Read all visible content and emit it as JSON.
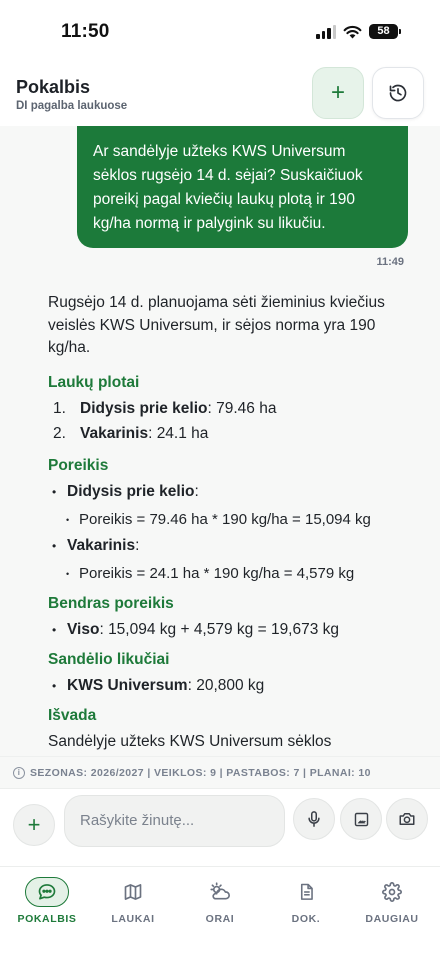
{
  "status": {
    "time": "11:50",
    "battery": "58"
  },
  "header": {
    "title": "Pokalbis",
    "subtitle": "DI pagalba laukuose"
  },
  "chat": {
    "user_message": "Ar sandėlyje užteks KWS Universum sėklos rugsėjo 14 d. sėjai? Suskaičiuok poreikį pagal kviečių laukų plotą ir 190 kg/ha normą ir palygink su likučiu.",
    "user_time": "11:49",
    "intro": "Rugsėjo 14 d. planuojama sėti žieminius kviečius veislės KWS Universum, ir sėjos norma yra 190 kg/ha.",
    "fields_heading": "Laukų plotai",
    "fields": [
      {
        "num": "1.",
        "name": "Didysis prie kelio",
        "value": ": 79.46 ha"
      },
      {
        "num": "2.",
        "name": "Vakarinis",
        "value": ": 24.1 ha"
      }
    ],
    "need_heading": "Poreikis",
    "needs": [
      {
        "name": "Didysis prie kelio",
        "suffix": ":",
        "calc": "Poreikis = 79.46 ha * 190 kg/ha = 15,094 kg"
      },
      {
        "name": "Vakarinis",
        "suffix": ":",
        "calc": "Poreikis = 24.1 ha * 190 kg/ha = 4,579 kg"
      }
    ],
    "total_heading": "Bendras poreikis",
    "total": {
      "name": "Viso",
      "value": ": 15,094 kg + 4,579 kg = 19,673 kg"
    },
    "stock_heading": "Sandėlio likučiai",
    "stock": {
      "name": "KWS Universum",
      "value": ": 20,800 kg"
    },
    "conclusion_heading": "Išvada",
    "conclusion": "Sandėlyje užteks KWS Universum sėklos"
  },
  "season_bar": "SEZONAS: 2026/2027 | VEIKLOS: 9 | PASTABOS: 7 | PLANAI: 10",
  "composer": {
    "placeholder": "Rašykite žinutę..."
  },
  "nav": [
    {
      "label": "POKALBIS",
      "icon": "chat-icon",
      "active": true
    },
    {
      "label": "LAUKAI",
      "icon": "map-icon",
      "active": false
    },
    {
      "label": "ORAI",
      "icon": "weather-icon",
      "active": false
    },
    {
      "label": "DOK.",
      "icon": "document-icon",
      "active": false
    },
    {
      "label": "DAUGIAU",
      "icon": "gear-icon",
      "active": false
    }
  ],
  "colors": {
    "accent": "#1c7a3a",
    "background": "#f7f8f7"
  }
}
